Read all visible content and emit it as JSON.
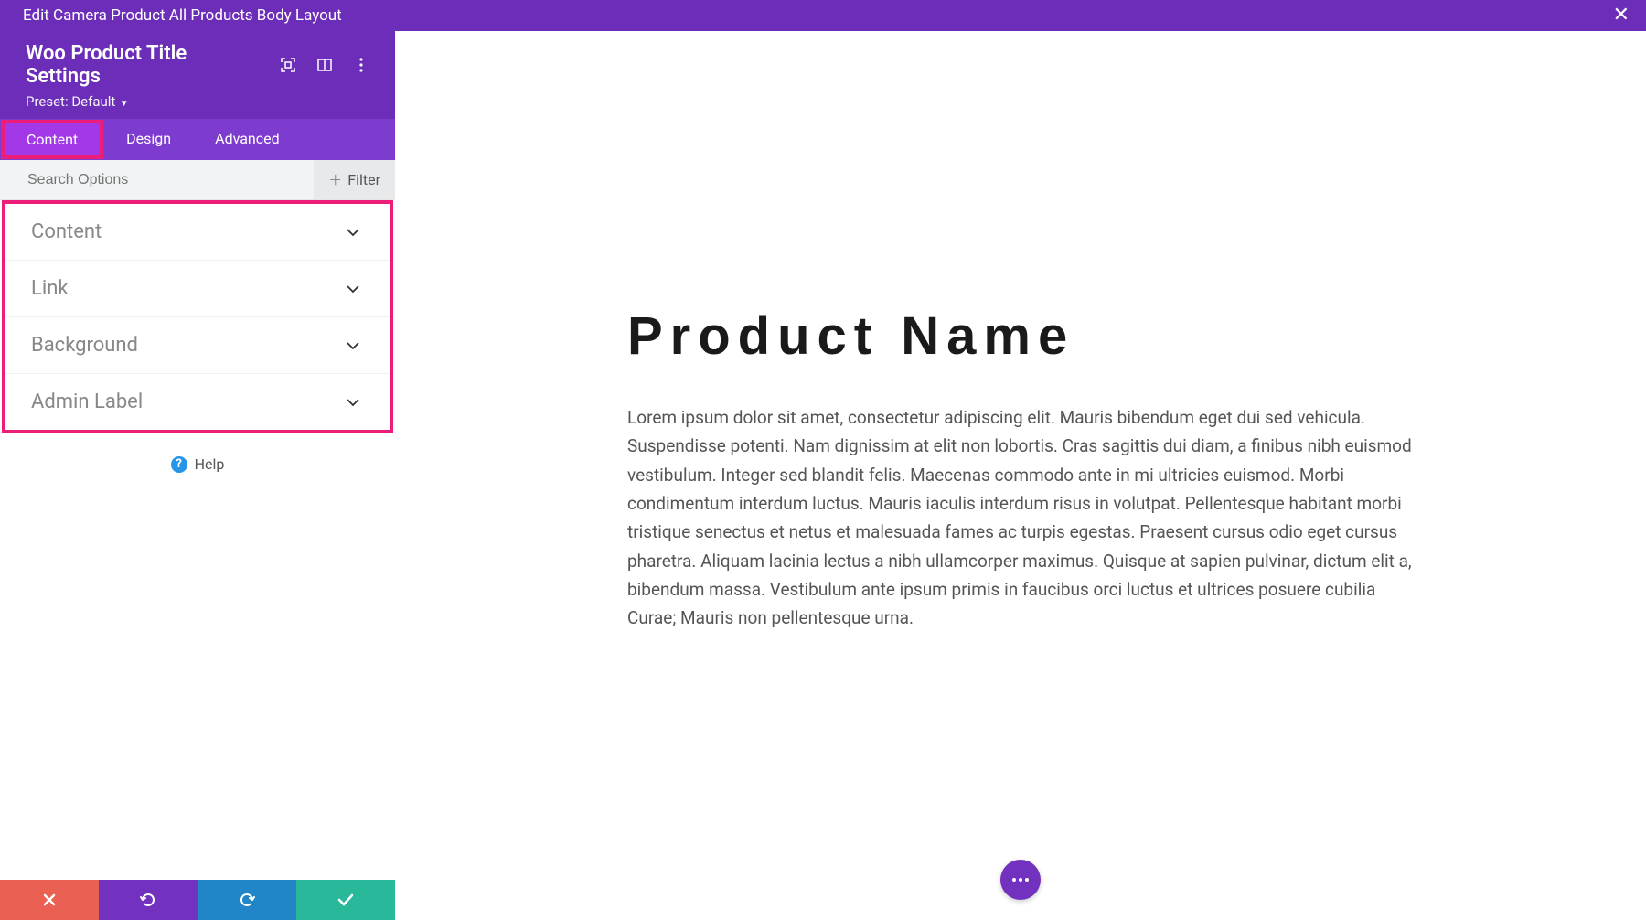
{
  "topbar": {
    "breadcrumb": "Edit Camera Product All Products Body Layout"
  },
  "sidebar": {
    "title": "Woo Product Title Settings",
    "preset_label": "Preset: Default",
    "tabs": [
      "Content",
      "Design",
      "Advanced"
    ],
    "active_tab": 0,
    "search_placeholder": "Search Options",
    "filter_label": "Filter",
    "sections": [
      "Content",
      "Link",
      "Background",
      "Admin Label"
    ],
    "help_label": "Help"
  },
  "preview": {
    "heading": "Product Name",
    "body": "Lorem ipsum dolor sit amet, consectetur adipiscing elit. Mauris bibendum eget dui sed vehicula. Suspendisse potenti. Nam dignissim at elit non lobortis. Cras sagittis dui diam, a finibus nibh euismod vestibulum. Integer sed blandit felis. Maecenas commodo ante in mi ultricies euismod. Morbi condimentum interdum luctus. Mauris iaculis interdum risus in volutpat. Pellentesque habitant morbi tristique senectus et netus et malesuada fames ac turpis egestas. Praesent cursus odio eget cursus pharetra. Aliquam lacinia lectus a nibh ullamcorper maximus. Quisque at sapien pulvinar, dictum elit a, bibendum massa. Vestibulum ante ipsum primis in faucibus orci luctus et ultrices posuere cubilia Curae; Mauris non pellentesque urna."
  },
  "colors": {
    "highlight": "#EC1E79"
  }
}
